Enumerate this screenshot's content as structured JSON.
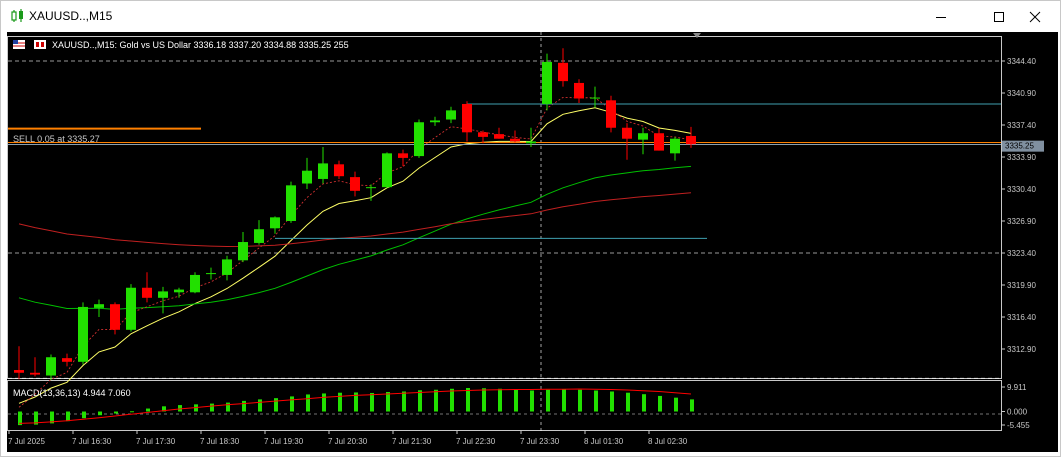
{
  "window": {
    "title": "XAUUSD..,M15",
    "buttons": {
      "minimize": "minimize",
      "maximize": "maximize",
      "close": "close"
    }
  },
  "chart_info": {
    "symbol_line": "XAUUSD..,M15:  Gold vs US Dollar  3336.18 3337.20 3334.88 3335.25  255"
  },
  "trade_line": {
    "label": "SELL 0.05 at 3335.27",
    "price": 3335.27
  },
  "current_price": {
    "label": "3335.25",
    "value": 3335.25
  },
  "macd": {
    "label": "MACD(13,36,13) 4.944 7.060"
  },
  "colors": {
    "bull": "#22e000",
    "bear": "#ff0000",
    "background": "#000000",
    "grid": "#ffffff",
    "fast_ma": "#ffff66",
    "mid_ma": "#00c000",
    "slow_ma": "#c02020",
    "dashed_ma": "#d03030",
    "resistance": "#3fa0b0",
    "trade": "#ff8000"
  },
  "chart_data": {
    "type": "candlestick",
    "price_axis_ticks": [
      "3344.40",
      "3340.90",
      "3337.40",
      "3333.90",
      "3330.40",
      "3326.90",
      "3323.40",
      "3319.90",
      "3316.40",
      "3312.90"
    ],
    "macd_axis_ticks": [
      "9.911",
      "0.000",
      "-5.455"
    ],
    "time_labels": [
      "7 Jul 2025",
      "7 Jul 16:30",
      "7 Jul 17:30",
      "7 Jul 18:30",
      "7 Jul 19:30",
      "7 Jul 20:30",
      "7 Jul 21:30",
      "7 Jul 22:30",
      "7 Jul 23:30",
      "8 Jul 01:30",
      "8 Jul 02:30"
    ],
    "candles": [
      {
        "o": 3310.6,
        "h": 3313.2,
        "l": 3309.6,
        "c": 3310.3
      },
      {
        "o": 3310.3,
        "h": 3312.0,
        "l": 3309.9,
        "c": 3310.1
      },
      {
        "o": 3310.0,
        "h": 3312.3,
        "l": 3309.5,
        "c": 3312.0
      },
      {
        "o": 3311.9,
        "h": 3312.4,
        "l": 3311.0,
        "c": 3311.5
      },
      {
        "o": 3311.5,
        "h": 3318.0,
        "l": 3311.2,
        "c": 3317.5
      },
      {
        "o": 3317.4,
        "h": 3318.3,
        "l": 3316.4,
        "c": 3317.8
      },
      {
        "o": 3317.8,
        "h": 3318.0,
        "l": 3314.5,
        "c": 3315.0
      },
      {
        "o": 3315.0,
        "h": 3320.0,
        "l": 3314.8,
        "c": 3319.6
      },
      {
        "o": 3319.6,
        "h": 3321.3,
        "l": 3318.0,
        "c": 3318.5
      },
      {
        "o": 3318.5,
        "h": 3319.7,
        "l": 3316.8,
        "c": 3319.2
      },
      {
        "o": 3319.1,
        "h": 3319.6,
        "l": 3318.5,
        "c": 3319.4
      },
      {
        "o": 3319.1,
        "h": 3321.3,
        "l": 3319.0,
        "c": 3321.0
      },
      {
        "o": 3321.1,
        "h": 3321.8,
        "l": 3320.5,
        "c": 3321.2
      },
      {
        "o": 3321.0,
        "h": 3323.1,
        "l": 3320.4,
        "c": 3322.7
      },
      {
        "o": 3322.6,
        "h": 3325.7,
        "l": 3322.4,
        "c": 3324.6
      },
      {
        "o": 3324.5,
        "h": 3327.0,
        "l": 3324.3,
        "c": 3326.0
      },
      {
        "o": 3326.1,
        "h": 3327.4,
        "l": 3325.5,
        "c": 3327.3
      },
      {
        "o": 3326.9,
        "h": 3331.2,
        "l": 3326.7,
        "c": 3330.8
      },
      {
        "o": 3331.0,
        "h": 3333.8,
        "l": 3330.4,
        "c": 3332.4
      },
      {
        "o": 3331.5,
        "h": 3335.0,
        "l": 3331.0,
        "c": 3333.2
      },
      {
        "o": 3333.1,
        "h": 3333.5,
        "l": 3331.5,
        "c": 3331.8
      },
      {
        "o": 3331.7,
        "h": 3332.3,
        "l": 3329.6,
        "c": 3330.2
      },
      {
        "o": 3330.5,
        "h": 3330.9,
        "l": 3329.1,
        "c": 3330.6
      },
      {
        "o": 3330.6,
        "h": 3334.4,
        "l": 3330.5,
        "c": 3334.3
      },
      {
        "o": 3334.3,
        "h": 3334.7,
        "l": 3332.9,
        "c": 3333.8
      },
      {
        "o": 3334.0,
        "h": 3338.0,
        "l": 3333.8,
        "c": 3337.7
      },
      {
        "o": 3337.7,
        "h": 3338.3,
        "l": 3337.3,
        "c": 3337.9
      },
      {
        "o": 3338.0,
        "h": 3339.4,
        "l": 3337.6,
        "c": 3339.0
      },
      {
        "o": 3339.7,
        "h": 3340.0,
        "l": 3335.6,
        "c": 3336.6
      },
      {
        "o": 3336.6,
        "h": 3336.8,
        "l": 3335.4,
        "c": 3336.1
      },
      {
        "o": 3336.4,
        "h": 3337.1,
        "l": 3335.9,
        "c": 3335.9
      },
      {
        "o": 3335.9,
        "h": 3336.8,
        "l": 3335.5,
        "c": 3335.6
      },
      {
        "o": 3335.4,
        "h": 3337.1,
        "l": 3335.0,
        "c": 3335.6
      },
      {
        "o": 3339.7,
        "h": 3345.2,
        "l": 3339.0,
        "c": 3344.3
      },
      {
        "o": 3344.2,
        "h": 3345.8,
        "l": 3341.6,
        "c": 3342.2
      },
      {
        "o": 3342.0,
        "h": 3342.4,
        "l": 3339.8,
        "c": 3340.3
      },
      {
        "o": 3340.3,
        "h": 3341.6,
        "l": 3339.3,
        "c": 3340.4
      },
      {
        "o": 3340.1,
        "h": 3340.6,
        "l": 3336.6,
        "c": 3337.1
      },
      {
        "o": 3337.1,
        "h": 3337.6,
        "l": 3333.6,
        "c": 3335.9
      },
      {
        "o": 3335.8,
        "h": 3337.1,
        "l": 3334.2,
        "c": 3336.5
      },
      {
        "o": 3336.5,
        "h": 3337.0,
        "l": 3334.6,
        "c": 3334.6
      },
      {
        "o": 3334.3,
        "h": 3336.1,
        "l": 3333.5,
        "c": 3335.9
      },
      {
        "o": 3336.2,
        "h": 3337.2,
        "l": 3334.9,
        "c": 3335.3
      }
    ],
    "macd_hist": [
      -5.5,
      -5.3,
      -4.8,
      -3.9,
      -2.7,
      -1.5,
      -0.8,
      0.1,
      1.2,
      2.1,
      2.6,
      2.9,
      3.2,
      3.6,
      4.3,
      4.9,
      5.4,
      6.1,
      6.9,
      7.3,
      7.6,
      7.7,
      7.5,
      7.9,
      8.1,
      8.6,
      8.8,
      9.2,
      9.5,
      9.4,
      9.2,
      8.8,
      8.5,
      8.8,
      8.9,
      8.8,
      8.5,
      8.1,
      7.6,
      7.0,
      6.3,
      5.6,
      4.9
    ],
    "macd_signal": [
      -4.8,
      -4.6,
      -4.2,
      -3.7,
      -3.1,
      -2.5,
      -1.8,
      -1.1,
      -0.4,
      0.3,
      1.0,
      1.6,
      2.2,
      2.7,
      3.2,
      3.7,
      4.2,
      4.7,
      5.2,
      5.7,
      6.1,
      6.5,
      6.8,
      7.1,
      7.4,
      7.7,
      8.0,
      8.3,
      8.5,
      8.7,
      8.8,
      8.9,
      8.9,
      9.0,
      9.0,
      9.1,
      9.0,
      8.9,
      8.7,
      8.4,
      8.1,
      7.6,
      7.1
    ]
  }
}
